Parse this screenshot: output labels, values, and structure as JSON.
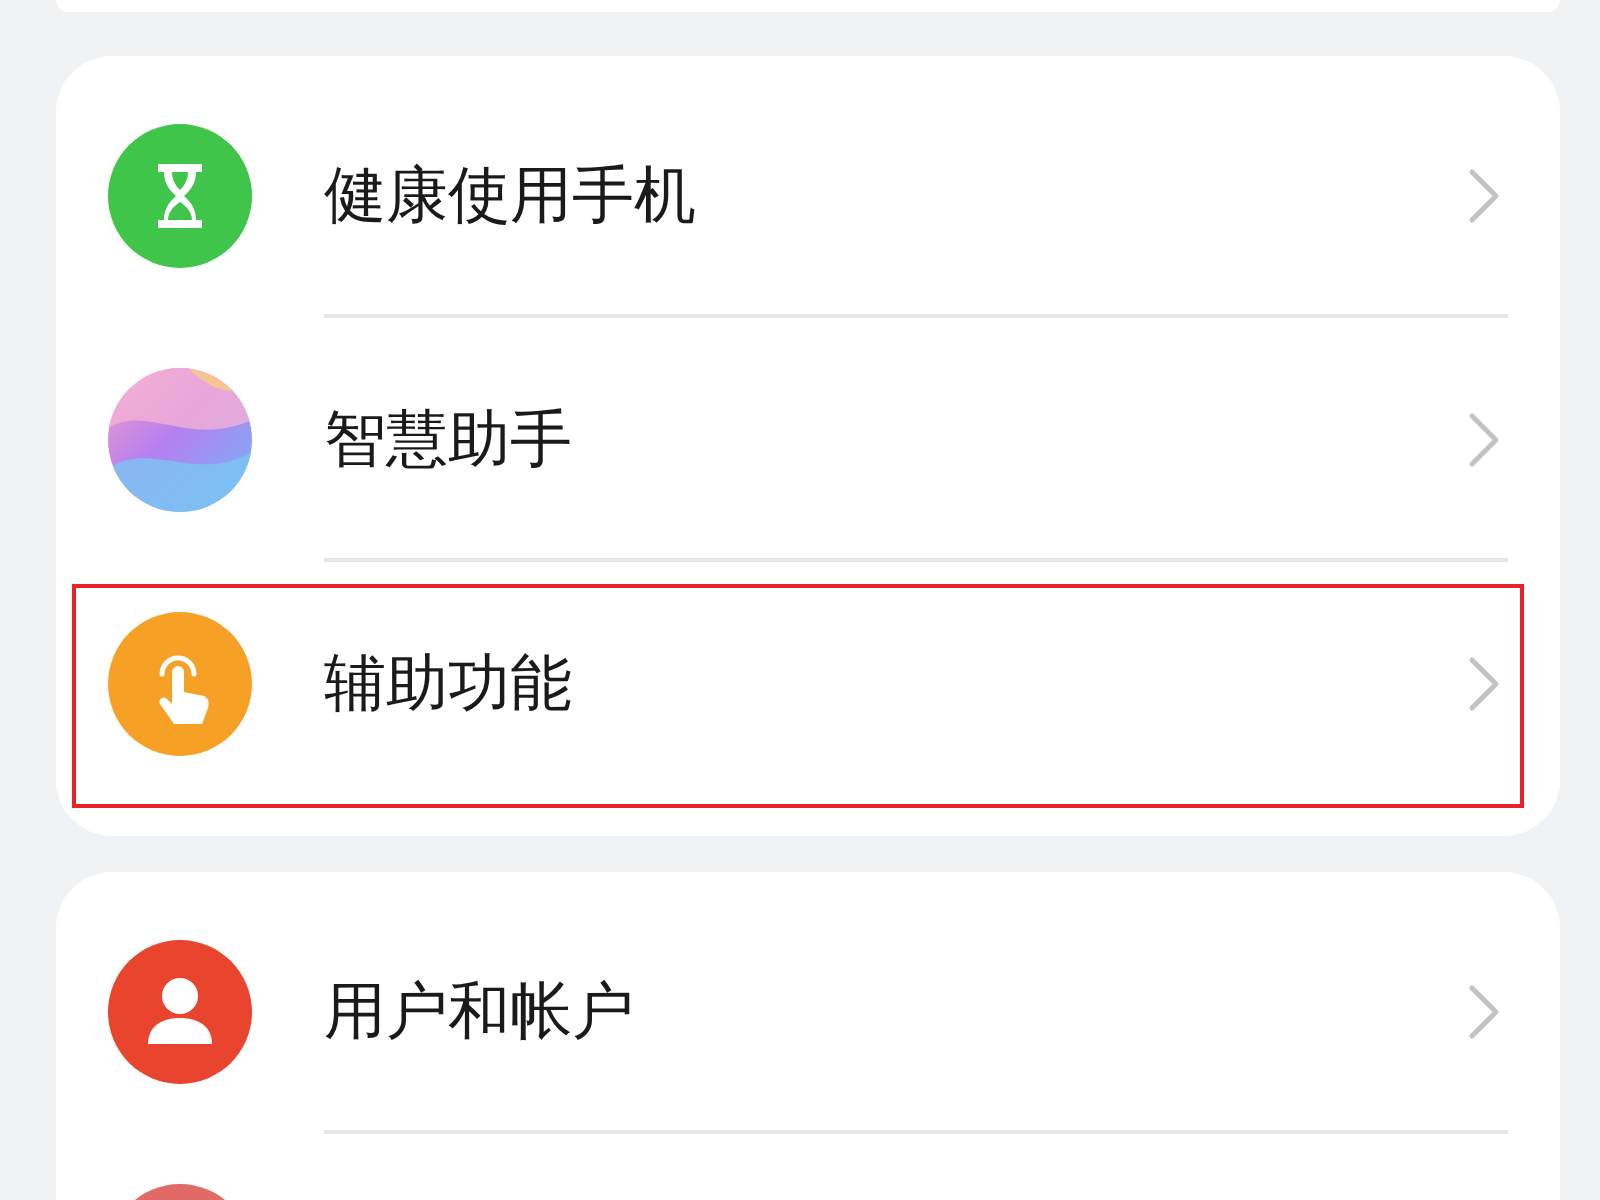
{
  "groups": [
    {
      "items": [
        {
          "label": "健康使用手机",
          "kind": "hourglass",
          "highlighted": false
        },
        {
          "label": "智慧助手",
          "kind": "orb",
          "highlighted": false
        },
        {
          "label": "辅助功能",
          "kind": "hand",
          "highlighted": true
        }
      ]
    },
    {
      "items": [
        {
          "label": "用户和帐户",
          "kind": "person",
          "highlighted": false
        },
        {
          "kind": "plain",
          "highlighted": false
        }
      ]
    }
  ]
}
